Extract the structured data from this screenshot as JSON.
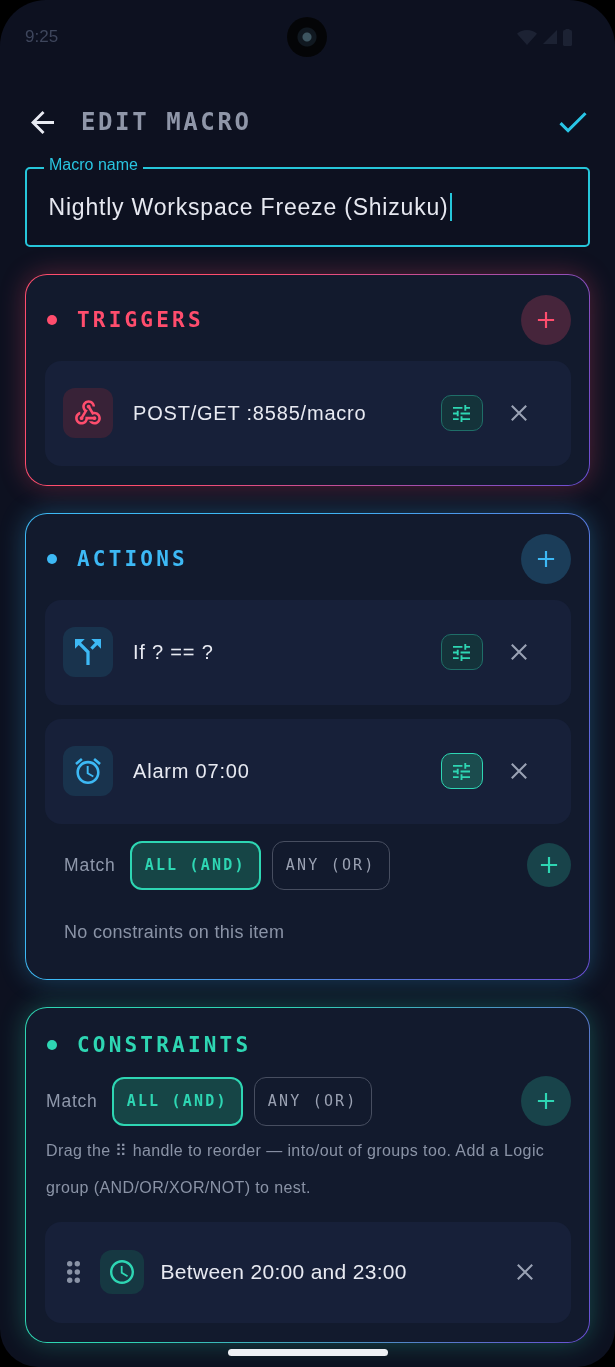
{
  "status_bar": {
    "time": "9:25"
  },
  "header": {
    "title": "EDIT MACRO"
  },
  "name_field": {
    "label": "Macro name",
    "value": "Nightly Workspace Freeze (Shizuku)"
  },
  "sections": [
    {
      "kind": "triggers",
      "title": "TRIGGERS",
      "color": "#ff4d6d",
      "items": [
        {
          "kind": "webhook",
          "label": "POST/GET :8585/macro",
          "expanded": false
        }
      ]
    },
    {
      "kind": "actions",
      "title": "ACTIONS",
      "color": "#3db9f5",
      "items": [
        {
          "kind": "condition",
          "label": "If ? == ?",
          "expanded": false
        },
        {
          "kind": "alarm",
          "label": "Alarm 07:00",
          "expanded": true,
          "constraints": {
            "label": "Match",
            "options": [
              {
                "label": "ALL (AND)",
                "selected": true
              },
              {
                "label": "ANY (OR)",
                "selected": false
              }
            ],
            "empty_text": "No constraints on this item"
          }
        }
      ]
    },
    {
      "kind": "constraints",
      "title": "CONSTRAINTS",
      "color": "#2ed6b3",
      "match": {
        "label": "Match",
        "options": [
          {
            "label": "ALL (AND)",
            "selected": true
          },
          {
            "label": "ANY (OR)",
            "selected": false
          }
        ]
      },
      "hint": "Drag the ⠿ handle to reorder — into/out of groups too. Add a Logic group (AND/OR/XOR/NOT) to nest.",
      "items": [
        {
          "kind": "time_window",
          "label": "Between 20:00 and 23:00"
        }
      ]
    }
  ]
}
